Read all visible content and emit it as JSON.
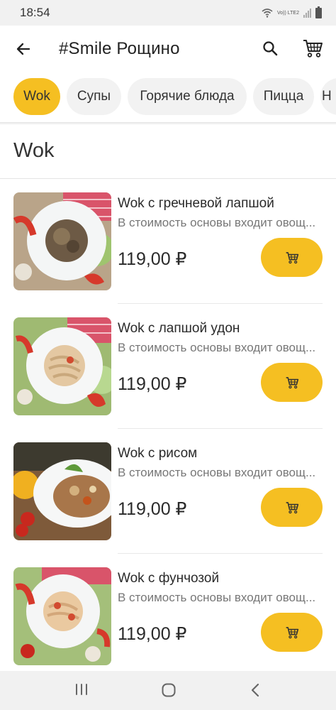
{
  "status": {
    "time": "18:54",
    "network": "Vo)) LTE2"
  },
  "header": {
    "title": "#Smile Рощино"
  },
  "chips": [
    {
      "label": "Wok",
      "active": true
    },
    {
      "label": "Супы",
      "active": false
    },
    {
      "label": "Горячие блюда",
      "active": false
    },
    {
      "label": "Пицца",
      "active": false
    },
    {
      "label": "Н",
      "active": false
    }
  ],
  "section": {
    "title": "Wok"
  },
  "items": [
    {
      "name": "Wok с гречневой лапшой",
      "description": "В стоимость основы входит овощ...",
      "price": "119,00 ₽"
    },
    {
      "name": "Wok с лапшой удон",
      "description": "В стоимость основы входит овощ...",
      "price": "119,00 ₽"
    },
    {
      "name": "Wok с рисом",
      "description": "В стоимость основы входит овощ...",
      "price": "119,00 ₽"
    },
    {
      "name": "Wok с фунчозой",
      "description": "В стоимость основы входит овощ...",
      "price": "119,00 ₽"
    }
  ],
  "colors": {
    "accent": "#f5bf22",
    "chip_bg": "#f2f2f2",
    "bar_bg": "#f1f1f1"
  },
  "icons": [
    "back-arrow-icon",
    "search-icon",
    "cart-icon",
    "menu-icon",
    "home-icon",
    "back-icon"
  ]
}
